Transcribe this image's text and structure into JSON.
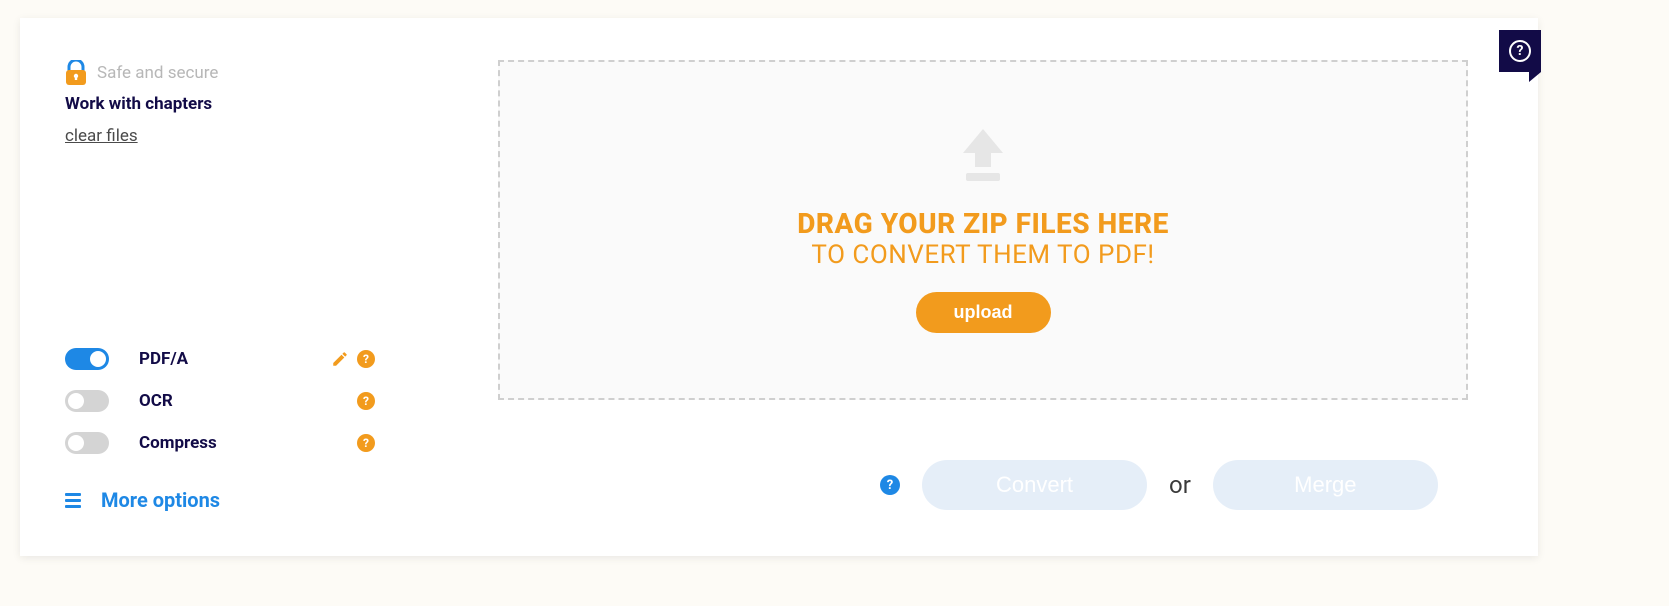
{
  "sidebar": {
    "safe_label": "Safe and secure",
    "chapters_label": "Work with chapters",
    "clear_label": "clear files"
  },
  "toggles": {
    "pdfa": {
      "label": "PDF/A",
      "on": true
    },
    "ocr": {
      "label": "OCR",
      "on": false
    },
    "compress": {
      "label": "Compress",
      "on": false
    }
  },
  "more_options_label": "More options",
  "dropzone": {
    "title": "DRAG YOUR ZIP FILES HERE",
    "subtitle": "TO CONVERT THEM TO PDF!",
    "upload_label": "upload"
  },
  "actions": {
    "convert_label": "Convert",
    "or_label": "or",
    "merge_label": "Merge"
  },
  "help_char": "?"
}
